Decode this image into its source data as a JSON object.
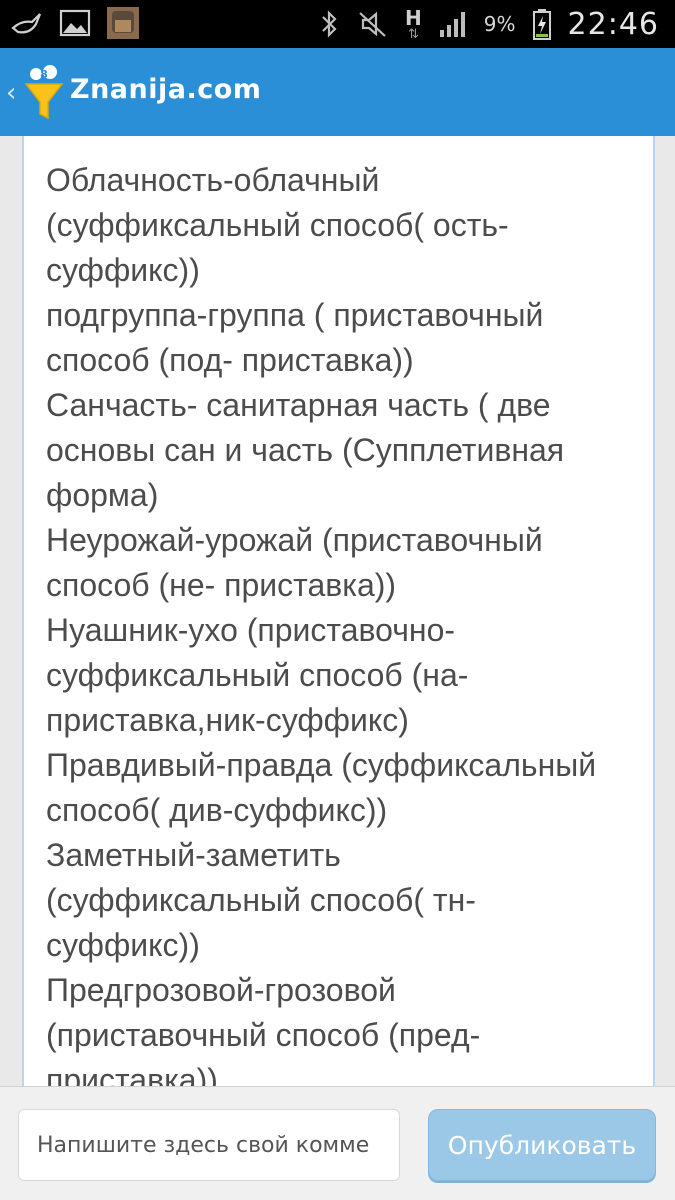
{
  "status_bar": {
    "clock": "22:46",
    "battery_percent": "9%",
    "network_type": "H",
    "icons": [
      "swift-bird-icon",
      "gallery-icon",
      "app-thumbnail-icon",
      "bluetooth-icon",
      "mute-icon",
      "network-h-icon",
      "signal-icon",
      "battery-icon"
    ]
  },
  "app_bar": {
    "title": "Znanija.com",
    "back_glyph": "‹"
  },
  "answer": {
    "lines": [
      "Облачность-облачный",
      "(суффиксальный способ( ость-",
      "суффикс))",
      "подгруппа-группа ( приставочный",
      "способ (под- приставка))",
      "Санчасть- санитарная часть ( две",
      "основы сан и часть (Супплетивная",
      "форма)",
      "Неурожай-урожай (приставочный",
      "способ (не- приставка))",
      "Нуашник-ухо (приставочно-",
      "суффиксальный способ (на-",
      "приставка,ник-суффикс)",
      "Правдивый-правда (суффиксальный",
      "способ( див-суффикс))",
      "Заметный-заметить",
      "(суффиксальный способ( тн-",
      "суффикс))",
      "Предгрозовой-грозовой",
      "(приставочный способ (пред-",
      "приставка))"
    ]
  },
  "comment": {
    "placeholder": "Напишите здесь свой комме",
    "publish_label": "Опубликовать"
  },
  "colors": {
    "app_bar": "#2a8fd6",
    "publish_button": "#9cc8e8",
    "status_bar": "#000000",
    "card_border": "#b9d6ee"
  }
}
